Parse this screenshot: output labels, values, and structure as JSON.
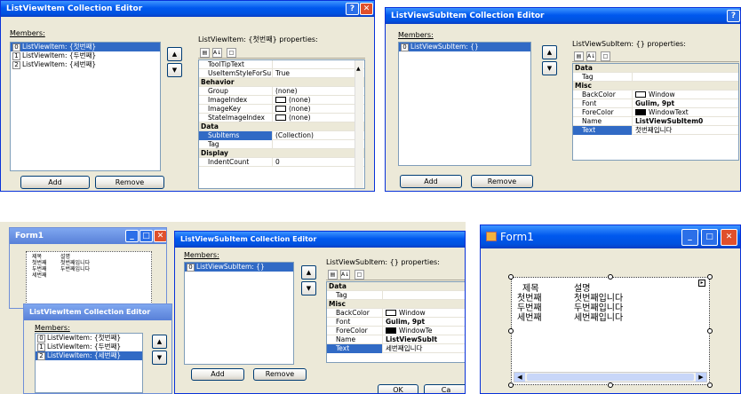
{
  "w1": {
    "title": "ListViewItem Collection Editor",
    "members_label": "Members:",
    "members": [
      {
        "index": "0",
        "text": "ListViewItem: {첫번째}"
      },
      {
        "index": "1",
        "text": "ListViewItem: {두번째}"
      },
      {
        "index": "2",
        "text": "ListViewItem: {세번째}"
      }
    ],
    "props_label": "ListViewItem: {첫번째} properties:",
    "props": [
      {
        "kind": "prop",
        "name": "ToolTipText",
        "value": ""
      },
      {
        "kind": "prop",
        "name": "UseItemStyleForSu",
        "value": "True"
      },
      {
        "kind": "cat",
        "name": "Behavior"
      },
      {
        "kind": "prop",
        "name": "Group",
        "value": "(none)"
      },
      {
        "kind": "prop",
        "name": "ImageIndex",
        "value": "(none)",
        "swatch": "#ffffff"
      },
      {
        "kind": "prop",
        "name": "ImageKey",
        "value": "(none)",
        "swatch": "#ffffff"
      },
      {
        "kind": "prop",
        "name": "StateImageIndex",
        "value": "(none)",
        "swatch": "#ffffff"
      },
      {
        "kind": "cat",
        "name": "Data"
      },
      {
        "kind": "prop",
        "name": "SubItems",
        "value": "(Collection)",
        "highlight": true
      },
      {
        "kind": "prop",
        "name": "Tag",
        "value": ""
      },
      {
        "kind": "cat",
        "name": "Display"
      },
      {
        "kind": "prop",
        "name": "IndentCount",
        "value": "0"
      }
    ],
    "add": "Add",
    "remove": "Remove"
  },
  "w2": {
    "title": "ListViewSubItem Collection Editor",
    "members_label": "Members:",
    "members": [
      {
        "index": "0",
        "text": "ListViewSubItem: {}"
      }
    ],
    "props_label": "ListViewSubItem: {} properties:",
    "props": [
      {
        "kind": "cat",
        "name": "Data"
      },
      {
        "kind": "prop",
        "name": "Tag",
        "value": ""
      },
      {
        "kind": "cat",
        "name": "Misc"
      },
      {
        "kind": "prop",
        "name": "BackColor",
        "value": "Window",
        "swatch": "#ffffff"
      },
      {
        "kind": "prop",
        "name": "Font",
        "value": "Gulim, 9pt",
        "bold": true
      },
      {
        "kind": "prop",
        "name": "ForeColor",
        "value": "WindowText",
        "swatch": "#000000"
      },
      {
        "kind": "prop",
        "name": "Name",
        "value": "ListViewSubItem0",
        "bold": true
      },
      {
        "kind": "prop",
        "name": "Text",
        "value": "첫번째입니다",
        "highlight": true
      }
    ],
    "add": "Add",
    "remove": "Remove"
  },
  "w3": {
    "form_title": "Form1",
    "form_cols": [
      "제목",
      "설명"
    ],
    "form_rows": [
      [
        "첫번째",
        "첫번째입니다"
      ],
      [
        "두번째",
        "두번째입니다"
      ],
      [
        "세번째",
        ""
      ]
    ],
    "lvi_title": "ListViewItem Collection Editor",
    "lvi_members_label": "Members:",
    "lvi_members": [
      {
        "index": "0",
        "text": "ListViewItem: {첫번째}"
      },
      {
        "index": "1",
        "text": "ListViewItem: {두번째}"
      },
      {
        "index": "2",
        "text": "ListViewItem: {세번째}"
      }
    ],
    "sub_title": "ListViewSubItem Collection Editor",
    "sub_members_label": "Members:",
    "sub_members": [
      {
        "index": "0",
        "text": "ListViewSubItem: {}"
      }
    ],
    "sub_props_label": "ListViewSubItem: {} properties:",
    "sub_props": [
      {
        "kind": "cat",
        "name": "Data"
      },
      {
        "kind": "prop",
        "name": "Tag",
        "value": ""
      },
      {
        "kind": "cat",
        "name": "Misc"
      },
      {
        "kind": "prop",
        "name": "BackColor",
        "value": "Window",
        "swatch": "#ffffff"
      },
      {
        "kind": "prop",
        "name": "Font",
        "value": "Gulim, 9pt",
        "bold": true
      },
      {
        "kind": "prop",
        "name": "ForeColor",
        "value": "WindowTe",
        "swatch": "#000000"
      },
      {
        "kind": "prop",
        "name": "Name",
        "value": "ListViewSubIt",
        "bold": true
      },
      {
        "kind": "prop",
        "name": "Text",
        "value": "세번째입니다",
        "highlight": true
      }
    ],
    "add": "Add",
    "remove": "Remove",
    "ok": "OK",
    "cancel": "Ca"
  },
  "w4": {
    "title": "Form1",
    "cols": [
      "제목",
      "설명"
    ],
    "rows": [
      [
        "첫번째",
        "첫번째입니다"
      ],
      [
        "두번째",
        "두번째입니다"
      ],
      [
        "세번째",
        "세번째입니다"
      ]
    ]
  },
  "colors": {
    "title_bar": "#0058ee",
    "selection": "#316ac5",
    "dialog_bg": "#ece9d8"
  }
}
